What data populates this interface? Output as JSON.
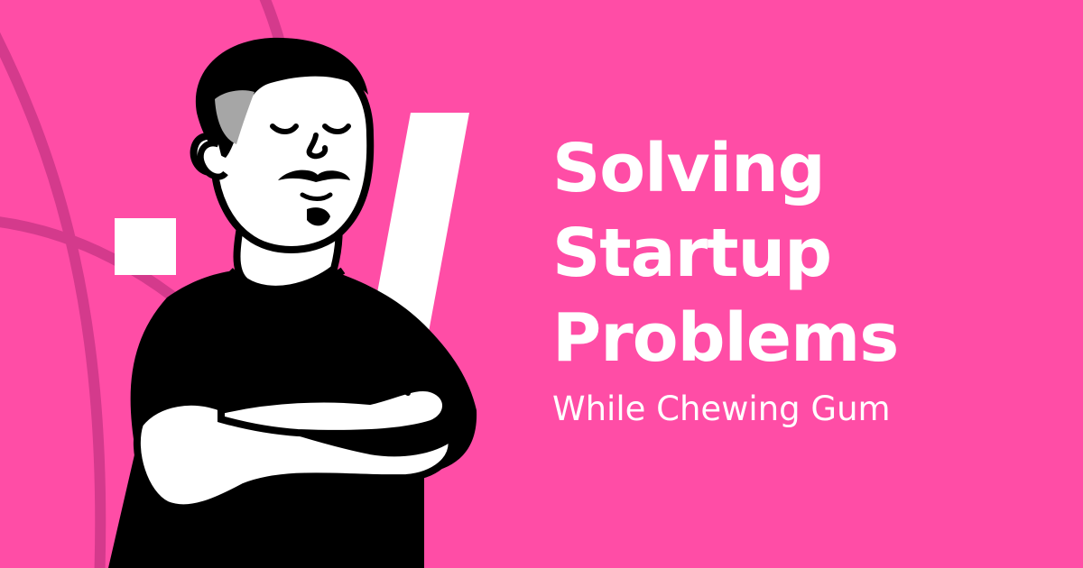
{
  "colors": {
    "background": "#FF4DA6",
    "arc": "#D43A8C",
    "text": "#FFFFFF",
    "ink": "#000000",
    "skin": "#FFFFFF",
    "hair_highlight": "#A6A6A6"
  },
  "headline": {
    "lines": [
      "Solving",
      "Startup",
      "Problems"
    ],
    "subtitle": "While Chewing Gum"
  },
  "illustration": {
    "subject": "man-with-crossed-arms",
    "icons": [
      "square-mark-icon",
      "slash-mark-icon"
    ]
  }
}
